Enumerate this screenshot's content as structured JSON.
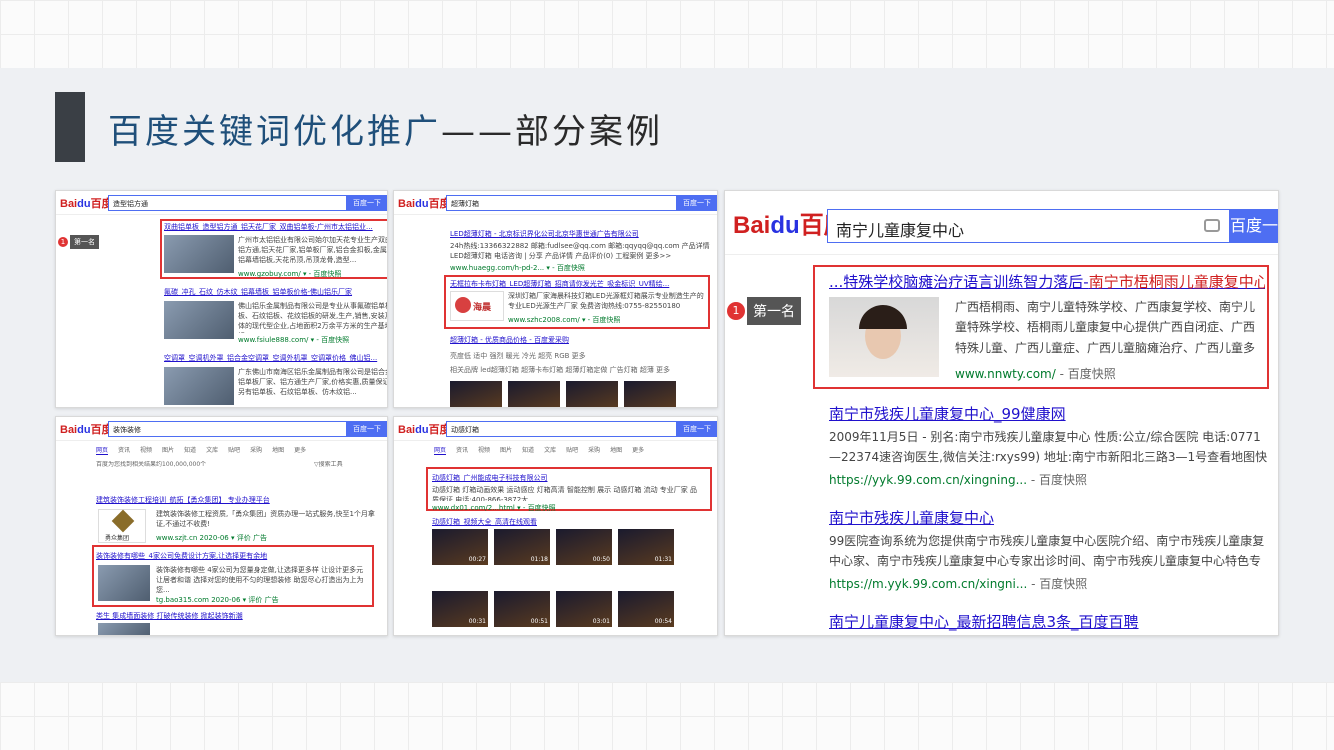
{
  "page": {
    "title_blue": "百度关键词优化推广",
    "title_dark": "——部分案例"
  },
  "search_button": "百度一下",
  "first_rank_label": "第一名",
  "first_rank_number": "1",
  "shots": {
    "s1": {
      "query": "造型铝方通",
      "r1_title": "双曲铝单板_造型铝方通_铝天花厂家_双曲铝单板-广州市太铝铝业...",
      "r1_text": "广州市太铝铝业有限公司始尔加天花专业生产双曲铝扣板,造型铝方通,铝天花厂家,铝单板厂家,铝合金扣板,金属天花,格栅天花,铝幕墙铝板,天花吊顶,吊顶龙骨,造型...",
      "r1_url": "www.gzobuy.com/ ▾ - 百度快照",
      "r2_title": "氟碳_冲孔_石纹_仿木纹_铝幕墙板_铝单板价格-佛山铝乐厂家",
      "r2_text": "佛山铝乐金属制品有限公司是专业从事氟碳铝单板、冲孔铝单板、石纹铝板、花纹铝板的研发,生产,销售,安装及技术服务于一体的现代型企业,占地面积2万余平方米的生产基地,拥有各类铝...",
      "r2_url": "www.fsiule888.com/ ▾ - 百度快照",
      "r3_title": "空调罩_空调机外罩_铝合金空调罩_空调外机罩_空调罩价格_佛山铝...",
      "r3_text": "广东佛山市南海区铝乐金属制品有限公司是铝合金空调罩、冲孔铝单板厂家、铝方通生产厂家,价格实惠,质量保证,可批发零售。另有铝单板、石纹铝单板、仿木纹铝..."
    },
    "s2": {
      "query": "超薄灯箱",
      "r1_title": "LED超薄灯箱 - 北京标识界化公司北京华惠世通广告有限公司",
      "r1_text": "24h热线:13366322882 邮箱:fudlsee@qq.com 邮箱:qqyqq@qq.com 产品详情 LED超薄灯箱 电话咨询 | 分享 产品详情 产品评价(0) 工程案例 更多>>",
      "r1_url": "www.huaegg.com/h-pd-2... ▾ - 百度快照",
      "r2_title": "无框拉布卡布灯箱_LED超薄灯箱_招商请你发光芒_吸金标识_UV精绘...",
      "r2_brand": "海晨",
      "r2_text": "深圳灯箱厂家海晨科技灯箱LED光源框灯箱展示专业制造生产的专业LED光源生产厂家 免费咨询热线:0755-82550180",
      "r2_url": "www.szhc2008.com/ ▾ - 百度快照",
      "r3_title": "超薄灯箱 - 优质商品价格 - 百度爱采购",
      "r3_row1": "亮度低 适中 强烈 暖光 冷光 超亮 RGB 更多",
      "r3_row2": "相关品牌 led超薄灯箱 超薄卡布灯箱 超薄灯箱定做 广告灯箱 超薄 更多"
    },
    "s3": {
      "query": "装饰装修",
      "tabs": [
        "网页",
        "资讯",
        "视频",
        "图片",
        "知道",
        "文库",
        "贴吧",
        "采购",
        "地图",
        "更多"
      ],
      "stats": "百度为您找到相关结果约100,000,000个",
      "tool": "▽搜索工具",
      "r1_title": "建筑装饰装修工程培训_航拓【勇众集团】 专业办理平台",
      "r1_brand": "勇众集团",
      "r1_text": "建筑装饰装修工程资质,「勇众集团」资质办理一站式服务,快至1个月拿证,不通过不收费!",
      "r1_url": "www.szjt.cn 2020-06 ▾ 评价 广告",
      "r2_title": "装饰装修有哪些_4家公司免费设计方案,让选择更有余地",
      "r2_text": "装饰装修有哪些 4家公司为您量身定做,让选择更多样 让设计更多元 让居者和谐 选择对您的使用不匀的理想装修 助您尽心打造出为上为您...",
      "r2_url": "tg.bao315.com 2020-06 ▾ 评价 广告",
      "r3_title": "类生 集成墙面装修 打破传统装修 掀起装饰新潮"
    },
    "s4": {
      "query": "动感灯箱",
      "tabs": [
        "网页",
        "资讯",
        "视频",
        "图片",
        "知道",
        "文库",
        "贴吧",
        "采购",
        "地图",
        "更多"
      ],
      "r1_title": "动感灯箱_广州能成电子科技有限公司",
      "r1_text": "动感灯箱 灯箱动画效果 运动感应 灯箱高清 智能控制 展示 动感灯箱 流动 专业厂家 品质保证 电话:400-866-3872大...",
      "r1_url": "www.dx01.com/2...html ▾ - 百度快照",
      "r2_title": "动感灯箱_视频大全_高清在线观看",
      "v_durations": [
        "00:27",
        "01:18",
        "00:50",
        "01:31",
        "00:31",
        "00:51",
        "03:01",
        "00:54"
      ]
    },
    "big": {
      "query": "南宁儿童康复中心",
      "r1_title_pre": "...特殊学校脑瘫治疗语言训练智力落后-",
      "r1_title_hl": "南宁市梧桐雨儿童康复中心",
      "r1_text": "广西梧桐雨、南宁儿童特殊学校、广西康复学校、南宁儿童特殊学校、梧桐雨儿童康复中心提供广西自闭症、广西特殊儿童、广西儿童症、广西儿童脑瘫治疗、广西儿童多动症、...",
      "r1_url": "www.nnwty.com/",
      "r1_snapshot": "- 百度快照",
      "r2_title": "南宁市残疾儿童康复中心_99健康网",
      "r2_text": "2009年11月5日 - 别名:南宁市残疾儿童康复中心 性质:公立/综合医院 电话:0771—22374速咨询医生,微信关注:rxys99) 地址:南宁市新阳北三路3—1号查看地图快速导...",
      "r2_url": "https://yyk.99.com.cn/xingning...",
      "r2_snapshot": "- 百度快照",
      "r3_title": "南宁市残疾儿童康复中心",
      "r3_text": "99医院查询系统为您提供南宁市残疾儿童康复中心医院介绍、南宁市残疾儿童康复中心家、南宁市残疾儿童康复中心专家出诊时间、南宁市残疾儿童康复中心特色专科、南...",
      "r3_url": "https://m.yyk.99.com.cn/xingni...",
      "r3_snapshot": "- 百度快照",
      "r4_title": "南宁儿童康复中心_最新招聘信息3条_百度百聘"
    }
  },
  "colors": {
    "title_blue": "#1f4f7a",
    "link_blue": "#2011cc",
    "highlight_red": "#d02020",
    "url_green": "#007a2c",
    "baidu_blue": "#4e6ef2"
  }
}
